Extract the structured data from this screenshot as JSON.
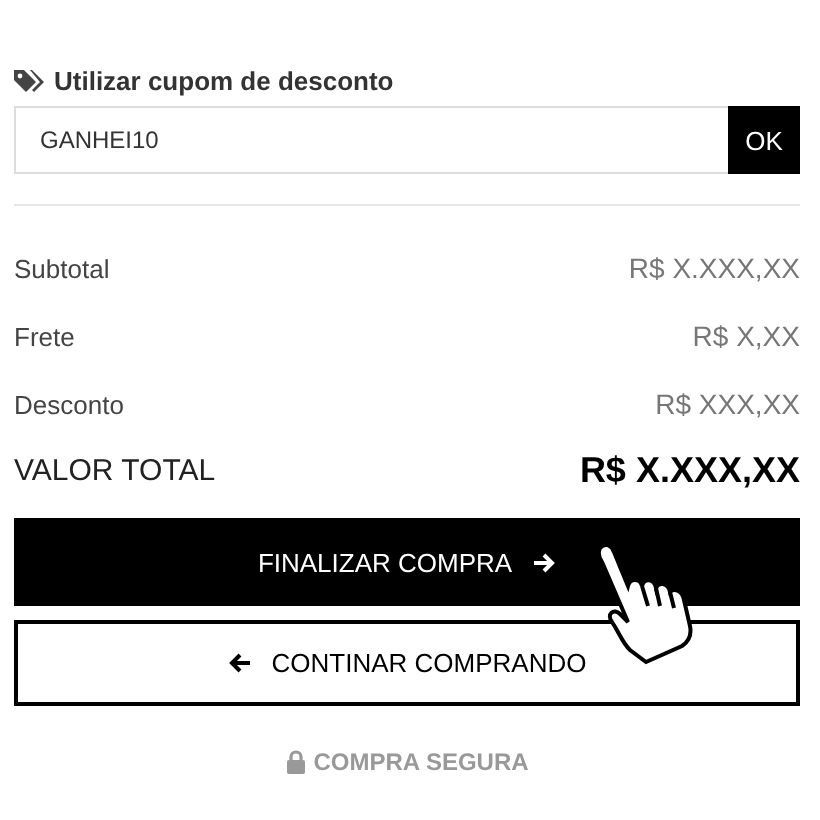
{
  "coupon": {
    "title": "Utilizar cupom de desconto",
    "value": "GANHEI10",
    "button": "OK"
  },
  "summary": [
    {
      "kind": "line",
      "label": "Subtotal",
      "value": "R$ X.XXX,XX"
    },
    {
      "kind": "line",
      "label": "Frete",
      "value": "R$ X,XX"
    },
    {
      "kind": "line",
      "label": "Desconto",
      "value": "R$ XXX,XX"
    },
    {
      "kind": "total",
      "label": "VALOR TOTAL",
      "value": "R$ X.XXX,XX"
    }
  ],
  "checkout_button": "FINALIZAR COMPRA",
  "continue_button": "CONTINAR COMPRANDO",
  "secure_note": "COMPRA SEGURA"
}
